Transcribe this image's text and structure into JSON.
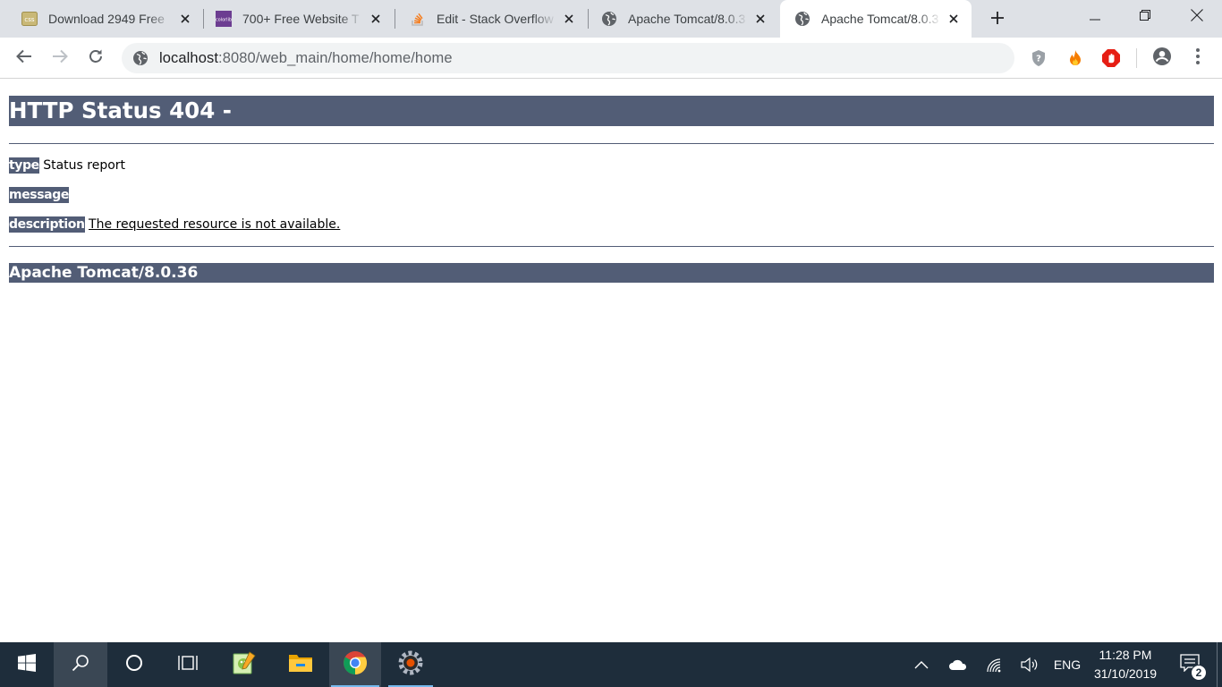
{
  "browser": {
    "tabs": [
      {
        "title": "Download 2949 Free",
        "favicon": "css-icon",
        "active": false
      },
      {
        "title": "700+ Free Website T",
        "favicon": "colorlib-icon",
        "active": false
      },
      {
        "title": "Edit - Stack Overflow",
        "favicon": "stackoverflow-icon",
        "active": false
      },
      {
        "title": "Apache Tomcat/8.0.3",
        "favicon": "globe-icon",
        "active": false
      },
      {
        "title": "Apache Tomcat/8.0.3",
        "favicon": "globe-icon",
        "active": true
      }
    ],
    "favicon_text": {
      "css": "css",
      "colorlib": "colorlib"
    },
    "url_host": "localhost",
    "url_rest": ":8080/web_main/home/home/home"
  },
  "page": {
    "title": "HTTP Status 404 -",
    "type_label": "type",
    "type_value": "Status report",
    "message_label": "message",
    "message_value": "",
    "description_label": "description",
    "description_value": "The requested resource is not available.",
    "footer": "Apache Tomcat/8.0.36"
  },
  "taskbar": {
    "language": "ENG",
    "time": "11:28 PM",
    "date": "31/10/2019",
    "notification_count": "2"
  },
  "colors": {
    "tomcat_header": "#525d76",
    "tabstrip": "#dee1e6",
    "taskbar": "#1e2d3b"
  }
}
